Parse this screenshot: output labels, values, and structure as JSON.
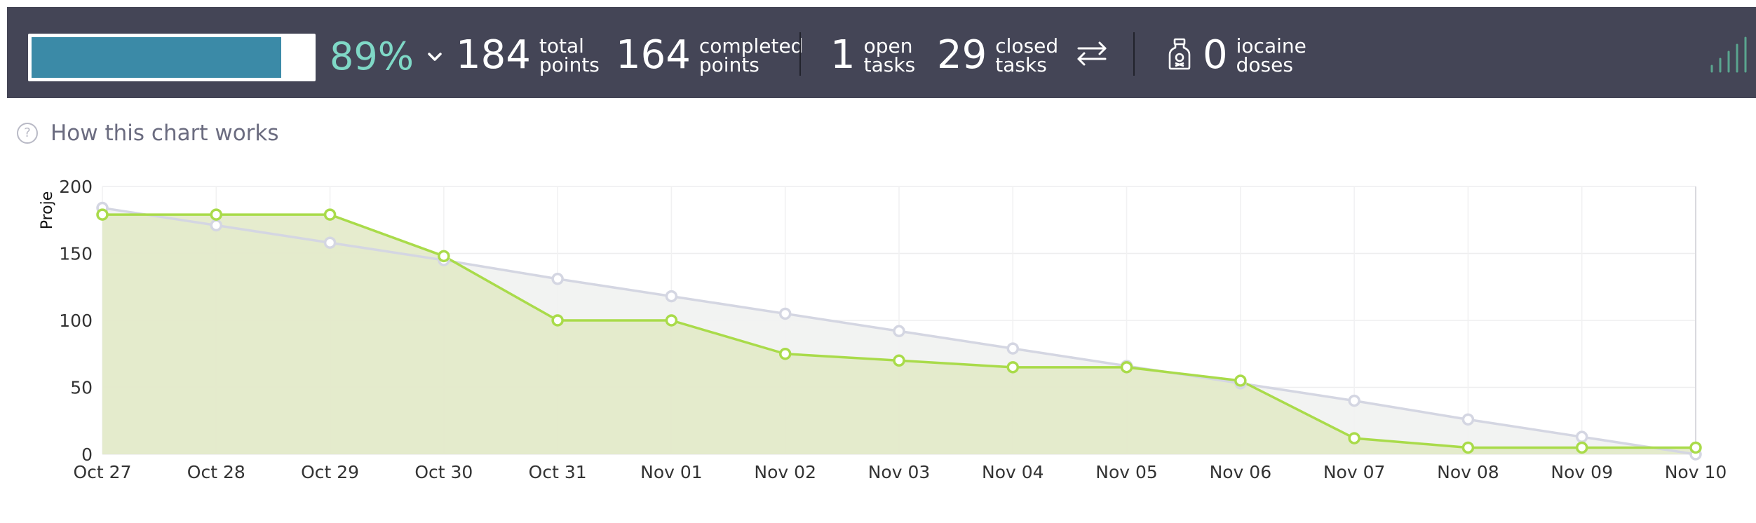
{
  "summary": {
    "progress_percent": 89,
    "percent_label": "89%",
    "total_points": "184",
    "total_points_label_1": "total",
    "total_points_label_2": "points",
    "completed_points": "164",
    "completed_points_label_1": "completed",
    "completed_points_label_2": "points",
    "open_tasks": "1",
    "open_tasks_label_1": "open",
    "open_tasks_label_2": "tasks",
    "closed_tasks": "29",
    "closed_tasks_label_1": "closed",
    "closed_tasks_label_2": "tasks",
    "iocaine_doses": "0",
    "iocaine_label_1": "iocaine",
    "iocaine_label_2": "doses",
    "icons": [
      "chevron-down-icon",
      "swap-arrows-icon",
      "poison-bottle-icon",
      "bar-chart-icon"
    ]
  },
  "help": {
    "label": "How this chart works"
  },
  "colors": {
    "header_bg": "#444556",
    "progress_fill": "#3b8aa7",
    "percent_text": "#7fd8c6",
    "actual_line": "#a9db4a",
    "actual_fill": "#e2e9c6",
    "ideal_line": "#d4d6e2",
    "ideal_fill": "#f1f2f1"
  },
  "chart_data": {
    "type": "area",
    "ylabel": "Proje",
    "categories": [
      "Oct 27",
      "Oct 28",
      "Oct 29",
      "Oct 30",
      "Oct 31",
      "Nov 01",
      "Nov 02",
      "Nov 03",
      "Nov 04",
      "Nov 05",
      "Nov 06",
      "Nov 07",
      "Nov 08",
      "Nov 09",
      "Nov 10"
    ],
    "ylim": [
      0,
      200
    ],
    "yticks": [
      0,
      50,
      100,
      150,
      200
    ],
    "grid": true,
    "series": [
      {
        "name": "",
        "values": [
          184,
          171,
          158,
          145,
          131,
          118,
          105,
          92,
          79,
          66,
          53,
          40,
          26,
          13,
          0
        ]
      },
      {
        "name": "",
        "values": [
          179,
          179,
          179,
          148,
          100,
          100,
          75,
          70,
          65,
          65,
          55,
          12,
          5,
          5,
          5
        ]
      }
    ]
  }
}
